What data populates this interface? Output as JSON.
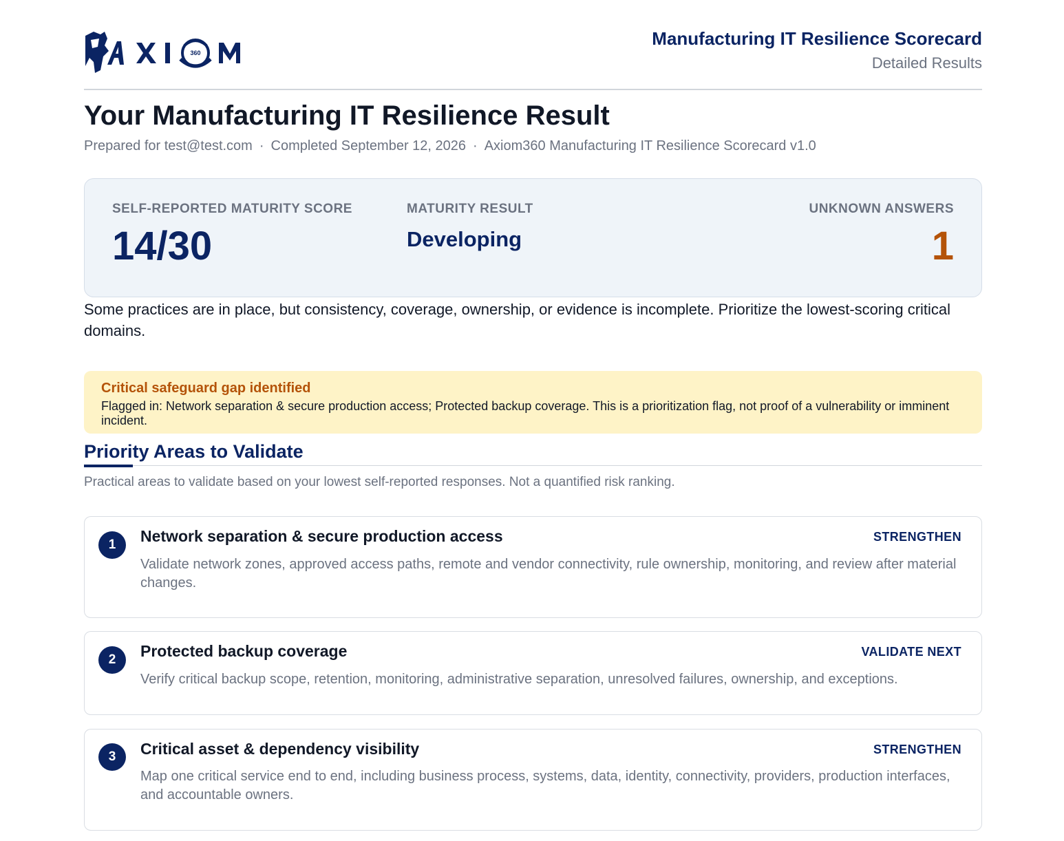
{
  "header": {
    "logo_text": "AXIOM 360",
    "title": "Manufacturing IT Resilience Scorecard",
    "subtitle": "Detailed Results"
  },
  "result": {
    "title": "Your Manufacturing IT Resilience Result",
    "prepared_for": "Prepared for test@test.com",
    "separator": "·",
    "completed": "Completed September 12, 2026",
    "version": "Axiom360 Manufacturing IT Resilience Scorecard v1.0"
  },
  "score_card": {
    "score_label": "SELF-REPORTED MATURITY SCORE",
    "score_value": "14/30",
    "maturity_label": "MATURITY RESULT",
    "maturity_value": "Developing",
    "unknown_label": "UNKNOWN ANSWERS",
    "unknown_value": "1"
  },
  "summary": "Some practices are in place, but consistency, coverage, ownership, or evidence is incomplete. Prioritize the lowest-scoring critical domains.",
  "alert": {
    "title": "Critical safeguard gap identified",
    "body": "Flagged in: Network separation & secure production access; Protected backup coverage. This is a prioritization flag, not proof of a vulnerability or imminent incident."
  },
  "priority_section": {
    "title": "Priority Areas to Validate",
    "description": "Practical areas to validate based on your lowest self-reported responses. Not a quantified risk ranking.",
    "items": [
      {
        "number": "1",
        "title": "Network separation & secure production access",
        "tag": "STRENGTHEN",
        "description": "Validate network zones, approved access paths, remote and vendor connectivity, rule ownership, monitoring, and review after material changes."
      },
      {
        "number": "2",
        "title": "Protected backup coverage",
        "tag": "VALIDATE NEXT",
        "description": "Verify critical backup scope, retention, monitoring, administrative separation, unresolved failures, ownership, and exceptions."
      },
      {
        "number": "3",
        "title": "Critical asset & dependency visibility",
        "tag": "STRENGTHEN",
        "description": "Map one critical service end to end, including business process, systems, data, identity, connectivity, providers, production interfaces, and accountable owners."
      }
    ]
  },
  "colors": {
    "brand_navy": "#0b2463",
    "accent_orange": "#b45309",
    "alert_bg": "#fef3c7",
    "card_bg": "#eff4f9"
  }
}
